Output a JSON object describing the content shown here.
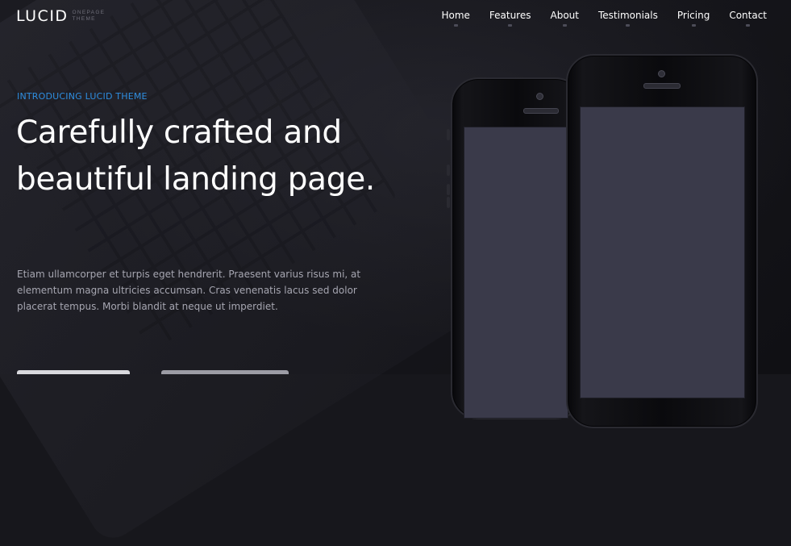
{
  "brand": {
    "name": "LUCID",
    "tagline": "ONEPAGE THEME"
  },
  "nav": {
    "items": [
      {
        "label": "Home"
      },
      {
        "label": "Features"
      },
      {
        "label": "About"
      },
      {
        "label": "Testimonials"
      },
      {
        "label": "Pricing"
      },
      {
        "label": "Contact"
      }
    ]
  },
  "hero": {
    "kicker": "INTRODUCING LUCID THEME",
    "headline": "Carefully crafted and beautiful landing page.",
    "lead": "Etiam ullamcorper et turpis eget hendrerit. Praesent varius risus mi, at elementum magna ultricies accumsan. Cras venenatis lacus sed dolor placerat tempus. Morbi blandit at neque ut imperdiet."
  },
  "colors": {
    "background": "#17171c",
    "accent": "#2e8ddf",
    "text": "#ffffff",
    "muted_text": "#a6a6b1",
    "phone_screen": "#3a3a4a"
  },
  "icons": {
    "phones": "smartphone-mockup",
    "background": "laptop-keyboard-photo"
  }
}
